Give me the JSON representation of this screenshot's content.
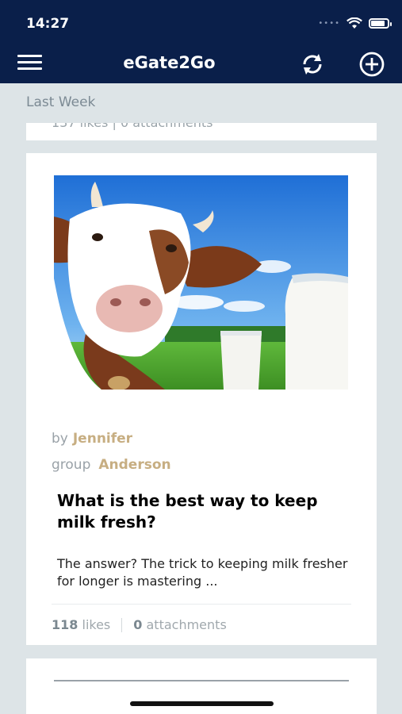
{
  "status_bar": {
    "time": "14:27",
    "battery_level": 0.85
  },
  "header": {
    "title": "eGate2Go",
    "menu_icon": "hamburger-menu-icon",
    "refresh_icon": "refresh-icon",
    "add_icon": "add-circle-icon",
    "background": "#0a1f4a"
  },
  "section": {
    "label": "Last Week"
  },
  "previous_card": {
    "meta_partial": "137 likes  |  0 attachments"
  },
  "post": {
    "by_label": "by",
    "author": "Jennifer",
    "group_label": "group",
    "group": "Anderson",
    "title": "What is the best way to keep milk fresh?",
    "excerpt": "The answer? The trick to keeping milk fresher for longer is mastering ...",
    "likes_count": "118",
    "likes_label": "likes",
    "attachments_count": "0",
    "attachments_label": "attachments",
    "accent_color": "#c7ae82"
  }
}
